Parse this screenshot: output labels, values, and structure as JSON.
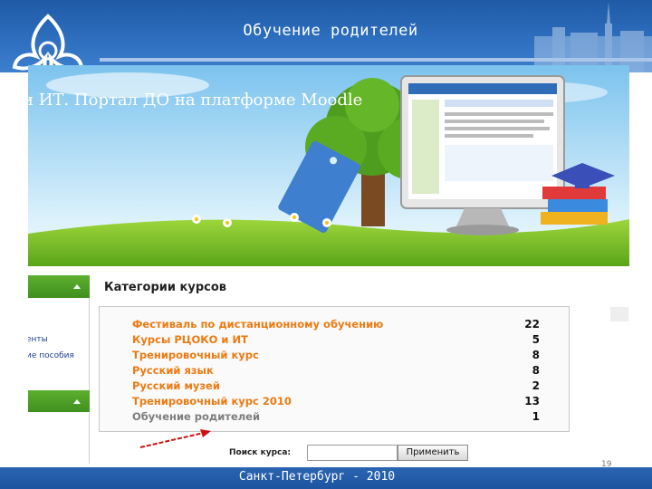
{
  "slide": {
    "title": "Обучение родителей",
    "footer": "Санкт-Петербург - 2010",
    "page_number": "19"
  },
  "banner": {
    "text": "и ИТ. Портал ДО на платформе Moodle",
    "tag_text": "Курсы и ИТ"
  },
  "sidebar": {
    "link1": "енты",
    "link2": "ие пособия"
  },
  "categories": {
    "heading": "Категории курсов",
    "items": [
      {
        "name": "Фестиваль по дистанционному обучению",
        "count": "22"
      },
      {
        "name": "Курсы РЦОКО и ИТ",
        "count": "5"
      },
      {
        "name": "Тренировочный курс",
        "count": "8"
      },
      {
        "name": "Русский язык",
        "count": "8"
      },
      {
        "name": "Русский музей",
        "count": "2"
      },
      {
        "name": "Тренировочный курс 2010",
        "count": "13"
      },
      {
        "name": "Обучение родителей",
        "count": "1"
      }
    ]
  },
  "search": {
    "label": "Поиск курса:",
    "value": "",
    "button": "Применить"
  },
  "colors": {
    "header_blue": "#2e6fbf",
    "link_orange": "#ec7a12",
    "bar_green": "#4fa226",
    "highlight_arrow": "#cc1111"
  }
}
